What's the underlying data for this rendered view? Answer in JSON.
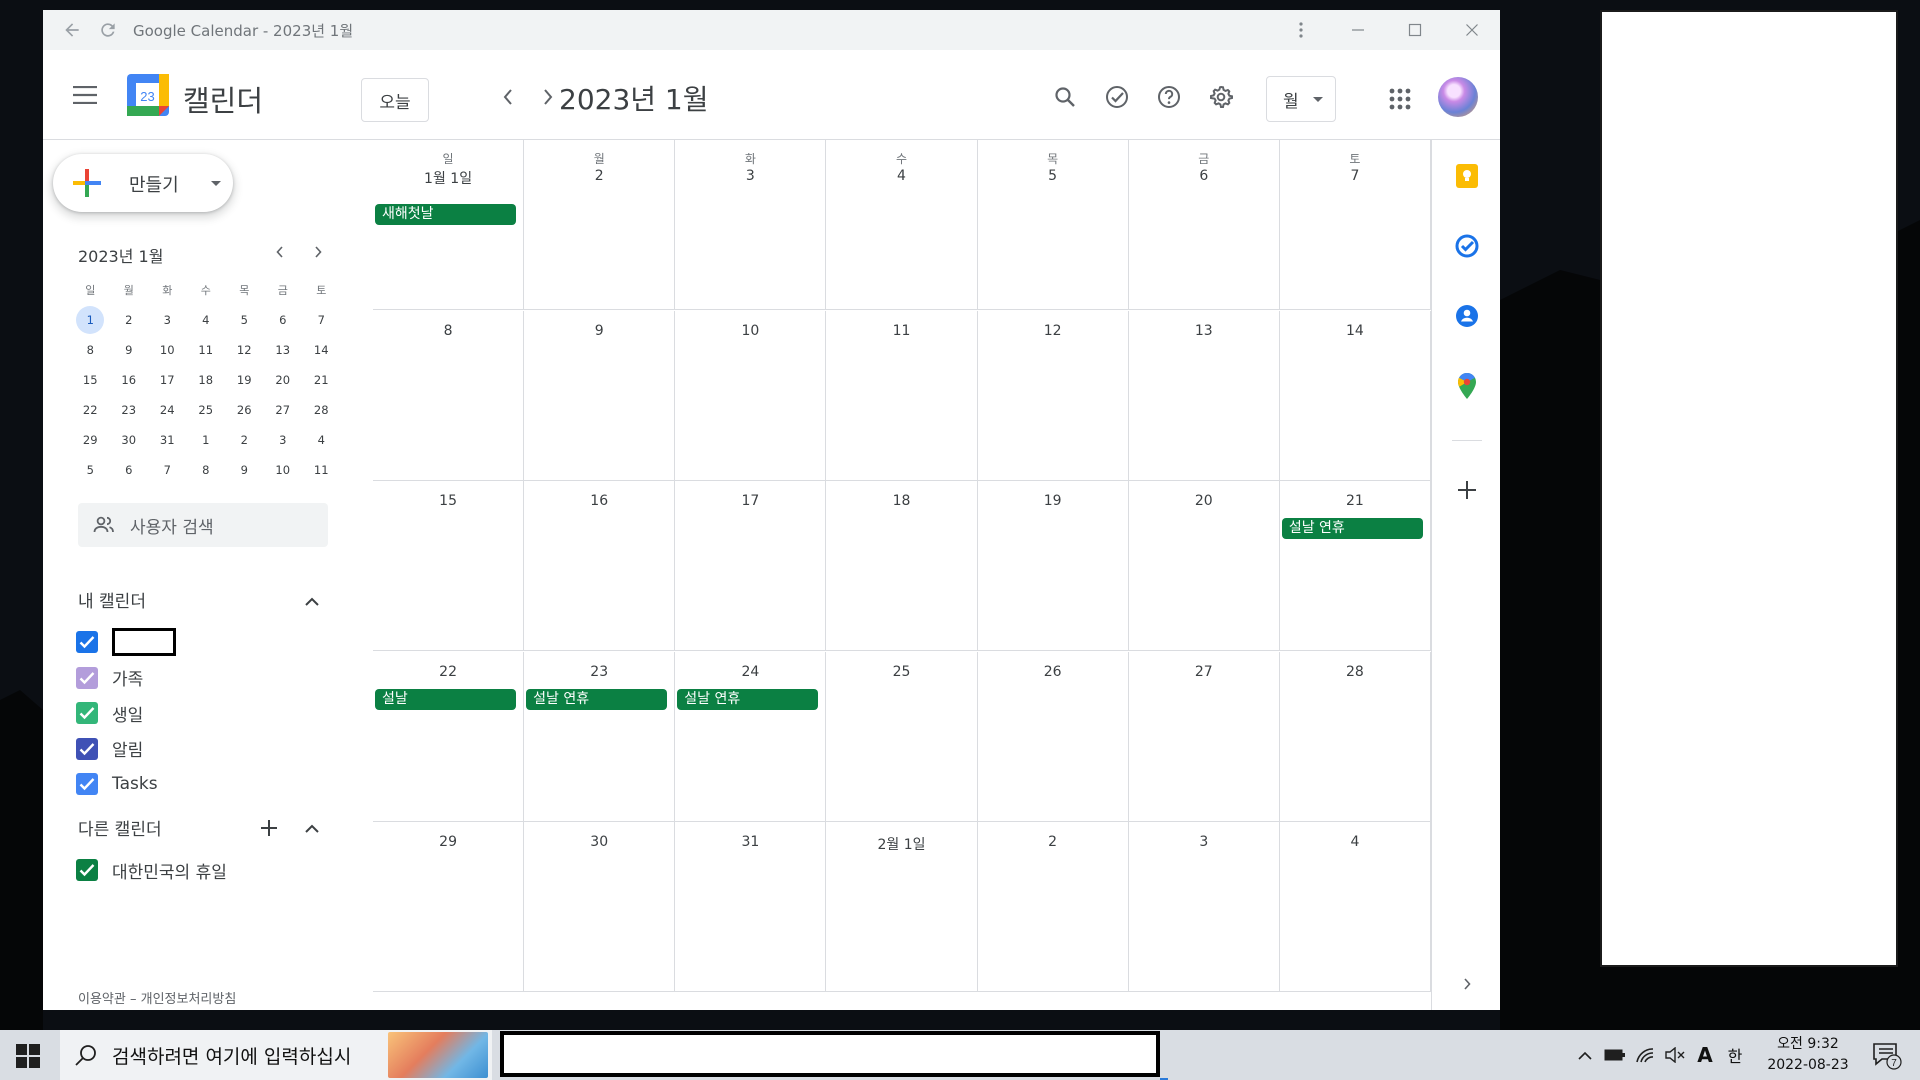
{
  "window": {
    "title": "Google Calendar - 2023년 1월"
  },
  "header": {
    "brand": "캘린더",
    "logo_day": "23",
    "today_label": "오늘",
    "current_month": "2023년 1월",
    "view_label": "월"
  },
  "sidebar": {
    "create_label": "만들기",
    "mini_month_title": "2023년 1월",
    "weekdays": [
      "일",
      "월",
      "화",
      "수",
      "목",
      "금",
      "토"
    ],
    "mini_weeks": [
      [
        "1",
        "2",
        "3",
        "4",
        "5",
        "6",
        "7"
      ],
      [
        "8",
        "9",
        "10",
        "11",
        "12",
        "13",
        "14"
      ],
      [
        "15",
        "16",
        "17",
        "18",
        "19",
        "20",
        "21"
      ],
      [
        "22",
        "23",
        "24",
        "25",
        "26",
        "27",
        "28"
      ],
      [
        "29",
        "30",
        "31",
        "1",
        "2",
        "3",
        "4"
      ],
      [
        "5",
        "6",
        "7",
        "8",
        "9",
        "10",
        "11"
      ]
    ],
    "people_search_placeholder": "사용자 검색",
    "my_calendars_title": "내 캘린더",
    "my_calendars": [
      {
        "label": "",
        "color": "#1a73e8"
      },
      {
        "label": "가족",
        "color": "#b39ddb"
      },
      {
        "label": "생일",
        "color": "#33b679"
      },
      {
        "label": "알림",
        "color": "#3f51b5"
      },
      {
        "label": "Tasks",
        "color": "#4285f4"
      }
    ],
    "other_calendars_title": "다른 캘린더",
    "other_calendars": [
      {
        "label": "대한민국의 휴일",
        "color": "#0b8043"
      }
    ],
    "footer": "이용약관 – 개인정보처리방침"
  },
  "month": {
    "weekdays": [
      "일",
      "월",
      "화",
      "수",
      "목",
      "금",
      "토"
    ],
    "weeks": [
      [
        {
          "n": "1월 1일",
          "ev": "새해첫날"
        },
        {
          "n": "2"
        },
        {
          "n": "3"
        },
        {
          "n": "4"
        },
        {
          "n": "5"
        },
        {
          "n": "6"
        },
        {
          "n": "7"
        }
      ],
      [
        {
          "n": "8"
        },
        {
          "n": "9"
        },
        {
          "n": "10"
        },
        {
          "n": "11"
        },
        {
          "n": "12"
        },
        {
          "n": "13"
        },
        {
          "n": "14"
        }
      ],
      [
        {
          "n": "15"
        },
        {
          "n": "16"
        },
        {
          "n": "17"
        },
        {
          "n": "18"
        },
        {
          "n": "19"
        },
        {
          "n": "20"
        },
        {
          "n": "21",
          "ev": "설날 연휴"
        }
      ],
      [
        {
          "n": "22",
          "ev": "설날"
        },
        {
          "n": "23",
          "ev": "설날 연휴"
        },
        {
          "n": "24",
          "ev": "설날 연휴"
        },
        {
          "n": "25"
        },
        {
          "n": "26"
        },
        {
          "n": "27"
        },
        {
          "n": "28"
        }
      ],
      [
        {
          "n": "29"
        },
        {
          "n": "30"
        },
        {
          "n": "31"
        },
        {
          "n": "2월 1일"
        },
        {
          "n": "2"
        },
        {
          "n": "3"
        },
        {
          "n": "4"
        }
      ]
    ],
    "event_color": "#0b8043"
  },
  "taskbar": {
    "search_placeholder": "검색하려면 여기에 입력하십시",
    "ime_label": "한",
    "font_label": "A",
    "time": "오전 9:32",
    "date": "2022-08-23",
    "notification_count": "7"
  },
  "colors": {
    "accent": "#1a73e8",
    "holiday": "#0b8043"
  }
}
